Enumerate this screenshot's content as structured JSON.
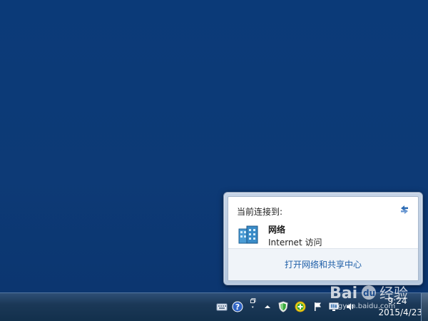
{
  "flyout": {
    "header": "当前连接到:",
    "network": {
      "name": "网络",
      "status": "Internet 访问"
    },
    "footer_link": "打开网络和共享中心"
  },
  "taskbar": {
    "tray_icons": [
      "keyboard-icon",
      "help-icon",
      "restore-windows-icon",
      "show-hidden-icons-arrow",
      "security-shield-icon",
      "green-plus-icon",
      "action-center-flag-icon",
      "network-icon",
      "volume-icon"
    ],
    "clock": {
      "time": "9:24",
      "date": "2015/4/23"
    }
  },
  "watermark": {
    "brand": "Bai",
    "brand2": "du",
    "brand_cn": "经验",
    "url": "jingyan.baidu.com"
  },
  "colors": {
    "desktop": "#0d3a76",
    "link": "#1f5fa8",
    "taskbar": "#1b3857"
  }
}
